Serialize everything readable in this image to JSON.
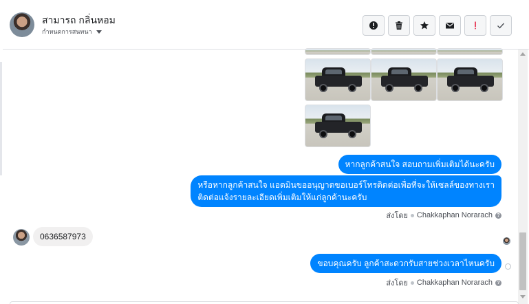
{
  "contact": {
    "name": "สามารถ กลิ่นหอม",
    "status_label": "กำหนดการสนทนา"
  },
  "actions": [
    {
      "name": "report-button",
      "icon": "exclamation-circle-icon"
    },
    {
      "name": "delete-button",
      "icon": "trash-icon"
    },
    {
      "name": "star-button",
      "icon": "star-icon"
    },
    {
      "name": "mark-unread-button",
      "icon": "envelope-icon"
    },
    {
      "name": "important-button",
      "icon": "exclamation-icon",
      "color": "#e41e3f"
    },
    {
      "name": "done-button",
      "icon": "checkmark-icon"
    }
  ],
  "messages": {
    "m1": "หากลูกค้าสนใจ สอบถามเพิ่มเติมได้นะครับ",
    "m2_line1": "หรือหากลูกค้าสนใจ แอดมินขออนุญาตขอเบอร์โทรติดต่อเพื่อที่จะให้เซลล์ของทางเรา",
    "m2_line2": "ติดต่อแจ้งรายละเอียดเพิ่มเติมให้แก่ลูกค้านะครับ",
    "phone": "0636587973",
    "m3": "ขอบคุณครับ ลูกค้าสะดวกรับสายช่วงเวลาไหนครับ"
  },
  "sent_by": {
    "prefix": "ส่งโดย",
    "name": "Chakkaphan Norarach"
  },
  "colors": {
    "bubble_sent": "#0084ff",
    "bubble_received": "#f1f0f0"
  }
}
